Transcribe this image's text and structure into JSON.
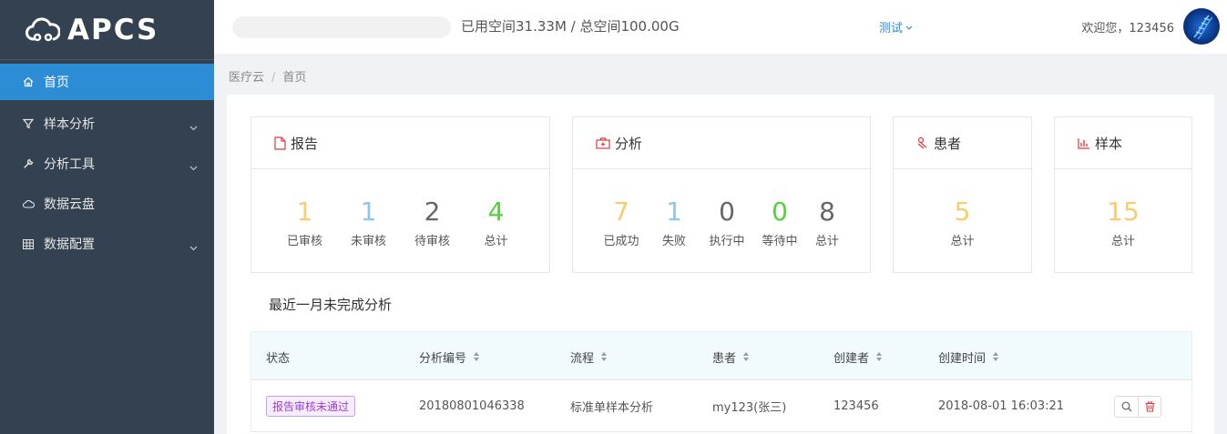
{
  "app": {
    "logo_text": "APCS"
  },
  "sidebar": {
    "items": [
      {
        "label": "首页",
        "icon": "home-icon",
        "active": true
      },
      {
        "label": "样本分析",
        "icon": "filter-icon",
        "has_submenu": true
      },
      {
        "label": "分析工具",
        "icon": "wrench-icon",
        "has_submenu": true
      },
      {
        "label": "数据云盘",
        "icon": "cloud-icon"
      },
      {
        "label": "数据配置",
        "icon": "grid-icon",
        "has_submenu": true
      }
    ]
  },
  "header": {
    "storage_text": "已用空间31.33M / 总空间100.00G",
    "test_menu": "测试",
    "welcome": "欢迎您，123456"
  },
  "breadcrumb": {
    "root": "医疗云",
    "sep": "/",
    "current": "首页"
  },
  "cards": {
    "report": {
      "title": "报告",
      "stats": [
        {
          "value": "1",
          "label": "已审核"
        },
        {
          "value": "1",
          "label": "未审核"
        },
        {
          "value": "2",
          "label": "待审核"
        },
        {
          "value": "4",
          "label": "总计"
        }
      ]
    },
    "analysis": {
      "title": "分析",
      "stats": [
        {
          "value": "7",
          "label": "已成功"
        },
        {
          "value": "1",
          "label": "失败"
        },
        {
          "value": "0",
          "label": "执行中"
        },
        {
          "value": "0",
          "label": "等待中"
        },
        {
          "value": "8",
          "label": "总计"
        }
      ]
    },
    "patient": {
      "title": "患者",
      "stats": [
        {
          "value": "5",
          "label": "总计"
        }
      ]
    },
    "sample": {
      "title": "样本",
      "stats": [
        {
          "value": "15",
          "label": "总计"
        }
      ]
    }
  },
  "recent": {
    "title": "最近一月未完成分析",
    "columns": [
      "状态",
      "分析编号",
      "流程",
      "患者",
      "创建者",
      "创建时间"
    ],
    "rows": [
      {
        "status": "报告审核未通过",
        "id": "20180801046338",
        "flow": "标准单样本分析",
        "patient": "my123(张三)",
        "creator": "123456",
        "created": "2018-08-01 16:03:21"
      }
    ]
  },
  "colors": {
    "sidebar_bg": "#334150",
    "active": "#2d8cd6",
    "yellow": "#f7cd6f",
    "blue": "#8dc7ee",
    "green": "#55d13d",
    "icon_red": "#e0393e"
  }
}
